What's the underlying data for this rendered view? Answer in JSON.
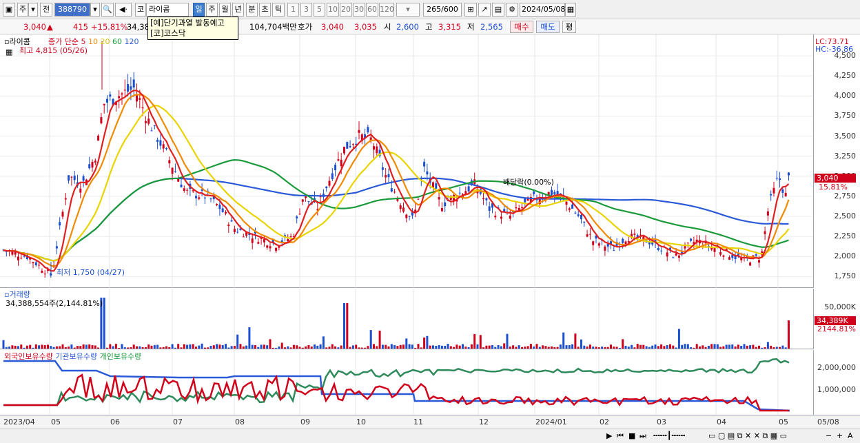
{
  "toolbar": {
    "tab_ju": "주",
    "tab_jeon": "전",
    "code_input": "388790",
    "market_label": "코",
    "stock_name": "라이콤",
    "periods": [
      "일",
      "주",
      "월",
      "년",
      "분",
      "초",
      "틱"
    ],
    "intervals": [
      "1",
      "3",
      "5",
      "10",
      "20",
      "30",
      "60",
      "120"
    ],
    "count": "265",
    "count_total": "/600",
    "date": "2024/05/08"
  },
  "info": {
    "price": "3,040",
    "change_arrow": "▲",
    "change": "415",
    "change_pct": "+15.81%",
    "volume_partial": "34,38",
    "amount": "104,704백만",
    "ask_label": "호가",
    "ask1": "3,040",
    "ask2": "3,035",
    "open_label": "시",
    "open": "2,600",
    "high_label": "고",
    "high": "3,315",
    "low_label": "저",
    "low": "2,565",
    "buy_label": "매수",
    "sell_label": "매도",
    "avg_label": "평"
  },
  "tooltip": {
    "line1": "[예]단기과열 발동예고",
    "line2": "[코]코스닥"
  },
  "price_panel": {
    "name": "라이콤",
    "ma_label": "종가 단순",
    "ma_periods": [
      {
        "p": "5",
        "color": "#e02020"
      },
      {
        "p": "10",
        "color": "#f08a00"
      },
      {
        "p": "20",
        "color": "#e8d400"
      },
      {
        "p": "60",
        "color": "#1a9a3a"
      },
      {
        "p": "120",
        "color": "#2a5ad8"
      }
    ],
    "high_note": "최고 4,815 (05/26)",
    "low_note": "최저 1,750 (04/27)",
    "dividend_note": "배당락(0.00%)",
    "lc": "LC:73.71",
    "hc": "HC:-36.86",
    "ticks": [
      "4,500",
      "4,250",
      "4,000",
      "3,750",
      "3,500",
      "3,250",
      "3,000",
      "2,750",
      "2,500",
      "2,250",
      "2,000",
      "1,750"
    ],
    "last_price": "3,040",
    "last_pct": "15.81%"
  },
  "volume_panel": {
    "name": "거래량",
    "value": "34,388,554주(2,144.81%)",
    "tick": "50,000K",
    "last_value": "34,389K",
    "last_pct": "2144.81%"
  },
  "holding_panel": {
    "legend": [
      {
        "label": "외국인보유수량",
        "color": "#d0021b"
      },
      {
        "label": "기관보유수량",
        "color": "#2a5ad8"
      },
      {
        "label": "개인보유수량",
        "color": "#1a9a3a"
      }
    ],
    "ticks": [
      "2,000,000",
      "1,000,000"
    ]
  },
  "x_axis": [
    "2023/04",
    "05",
    "06",
    "07",
    "08",
    "09",
    "10",
    "11",
    "12",
    "2024/01",
    "02",
    "03",
    "04",
    "05",
    "05/08"
  ],
  "colors": {
    "up": "#d0021b",
    "down": "#1b4fd0",
    "panel_border": "#9aa0b0"
  }
}
